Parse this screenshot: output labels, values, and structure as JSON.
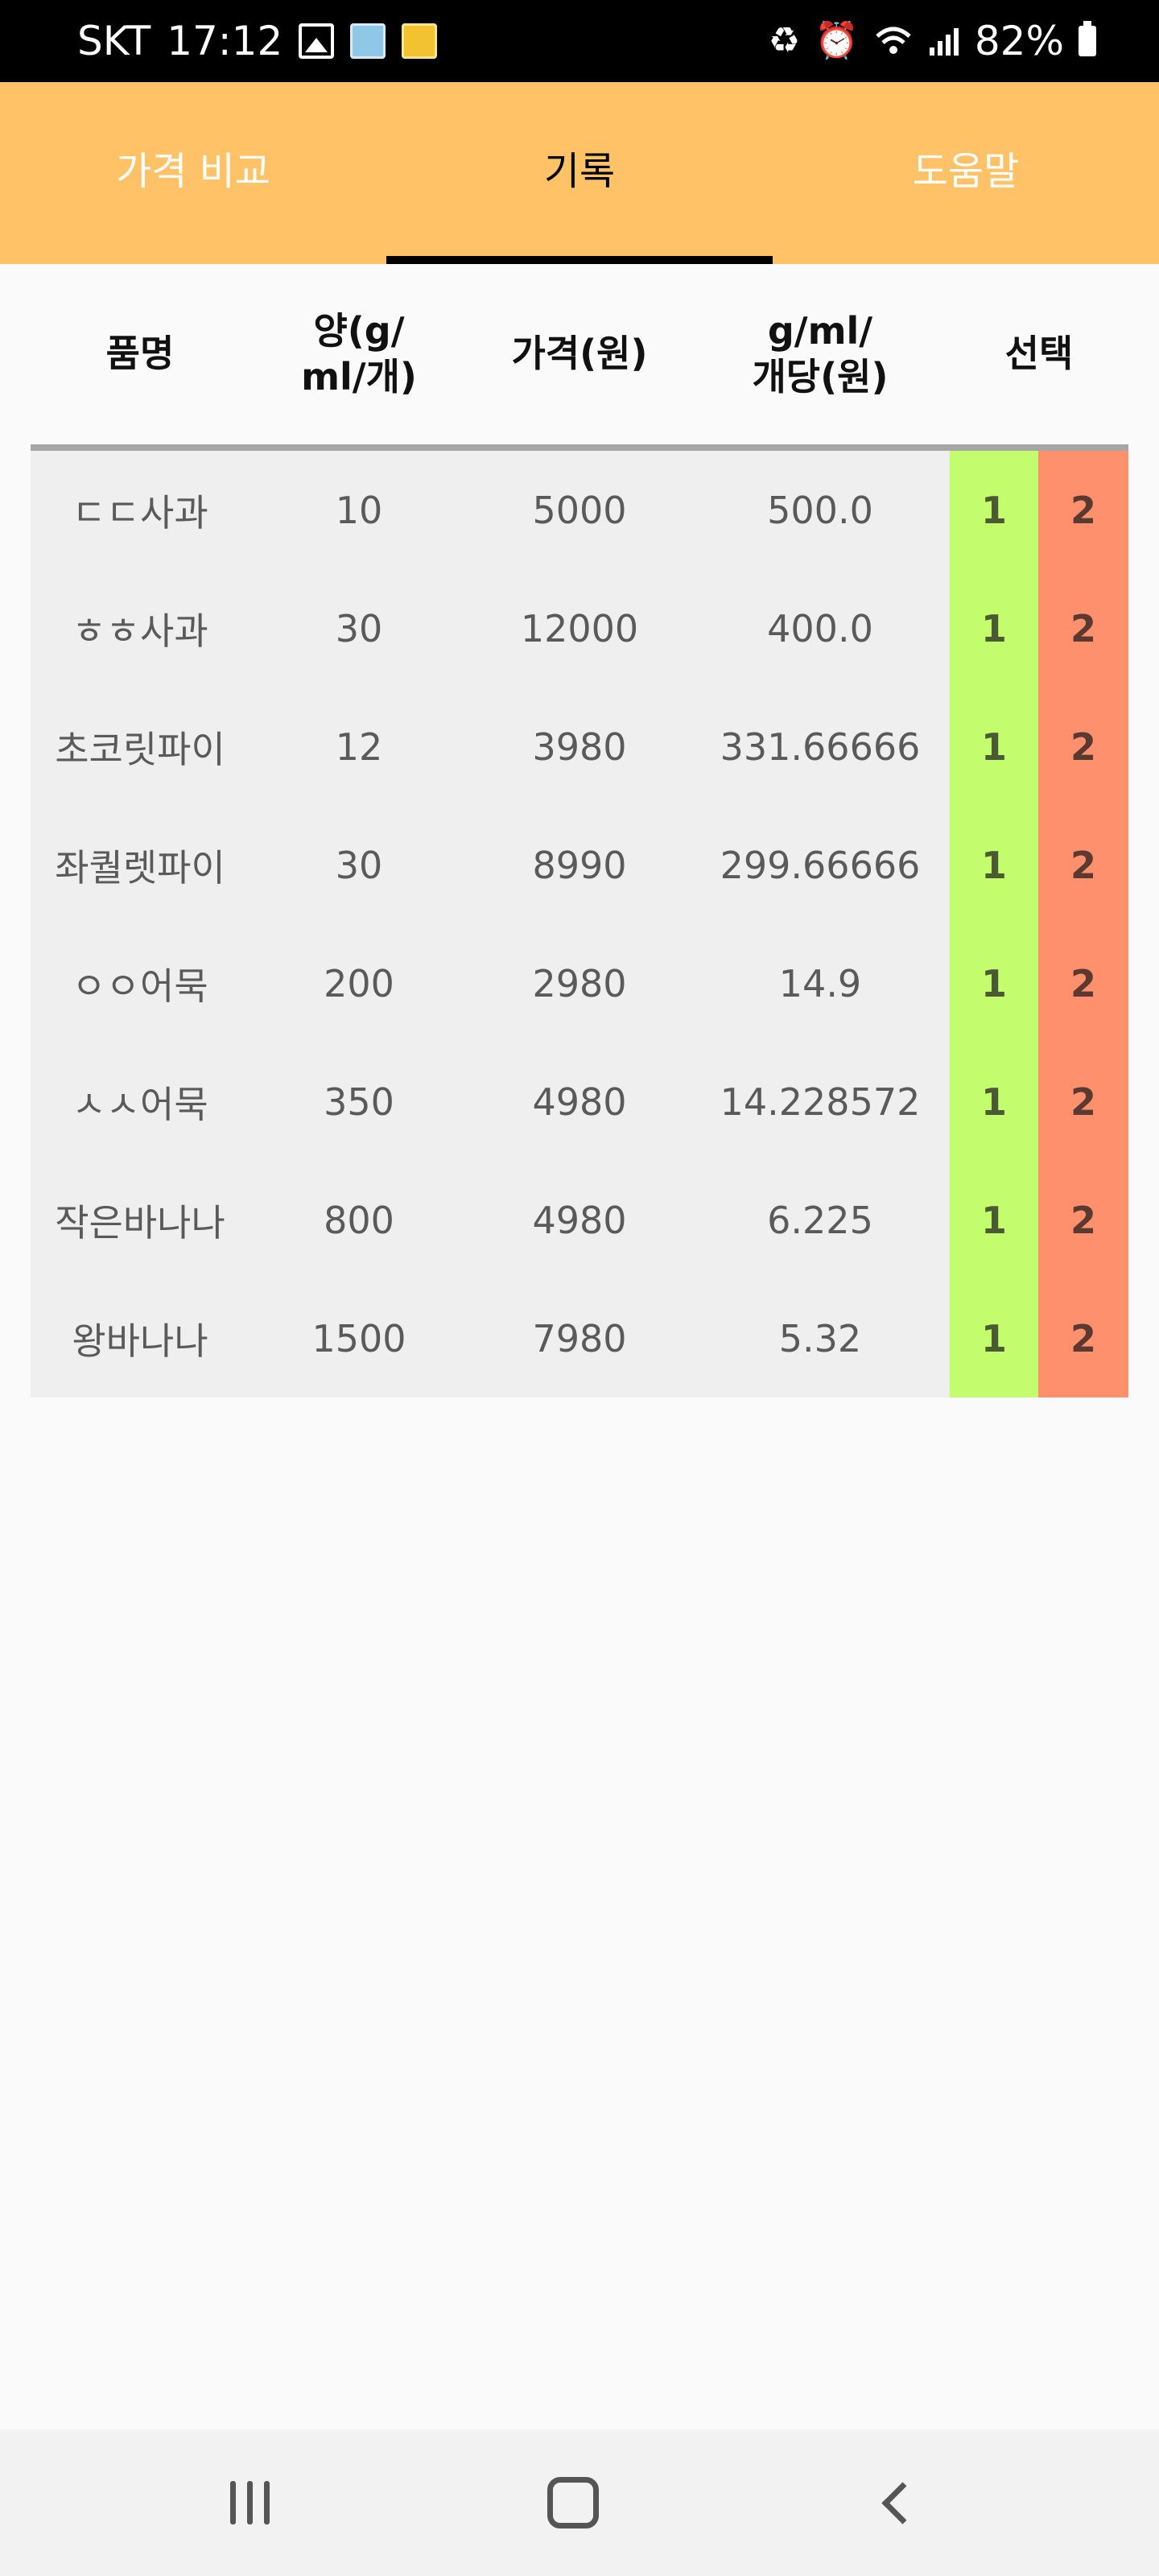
{
  "status_bar": {
    "carrier": "SKT",
    "time": "17:12",
    "battery": "82%"
  },
  "tabs": [
    {
      "label": "가격 비교",
      "active": false
    },
    {
      "label": "기록",
      "active": true
    },
    {
      "label": "도움말",
      "active": false
    }
  ],
  "table": {
    "headers": {
      "name": "품명",
      "quantity_line1": "양(g/",
      "quantity_line2": "ml/개)",
      "price": "가격(원)",
      "unit_line1": "g/ml/",
      "unit_line2": "개당(원)",
      "select": "선택"
    },
    "select_labels": [
      "1",
      "2"
    ],
    "rows": [
      {
        "name": "ㄷㄷ사과",
        "quantity": "10",
        "price": "5000",
        "unit_price": "500.0"
      },
      {
        "name": "ㅎㅎ사과",
        "quantity": "30",
        "price": "12000",
        "unit_price": "400.0"
      },
      {
        "name": "초코릿파이",
        "quantity": "12",
        "price": "3980",
        "unit_price": "331.66666"
      },
      {
        "name": "좌퀄렛파이",
        "quantity": "30",
        "price": "8990",
        "unit_price": "299.66666"
      },
      {
        "name": "ㅇㅇ어묵",
        "quantity": "200",
        "price": "2980",
        "unit_price": "14.9"
      },
      {
        "name": "ㅅㅅ어묵",
        "quantity": "350",
        "price": "4980",
        "unit_price": "14.228572"
      },
      {
        "name": "작은바나나",
        "quantity": "800",
        "price": "4980",
        "unit_price": "6.225"
      },
      {
        "name": "왕바나나",
        "quantity": "1500",
        "price": "7980",
        "unit_price": "5.32"
      }
    ]
  },
  "colors": {
    "tab_bar": "#ffc266",
    "select_1": "#c3fc6d",
    "select_2": "#ff906e",
    "row_background": "#efefef"
  },
  "icons": {
    "status": [
      "gallery-icon",
      "save-icon",
      "memo-icon",
      "recycle-icon",
      "alarm-icon",
      "wifi-icon",
      "signal-icon",
      "battery-icon"
    ],
    "navigation": [
      "recents-icon",
      "home-icon",
      "back-icon"
    ]
  }
}
